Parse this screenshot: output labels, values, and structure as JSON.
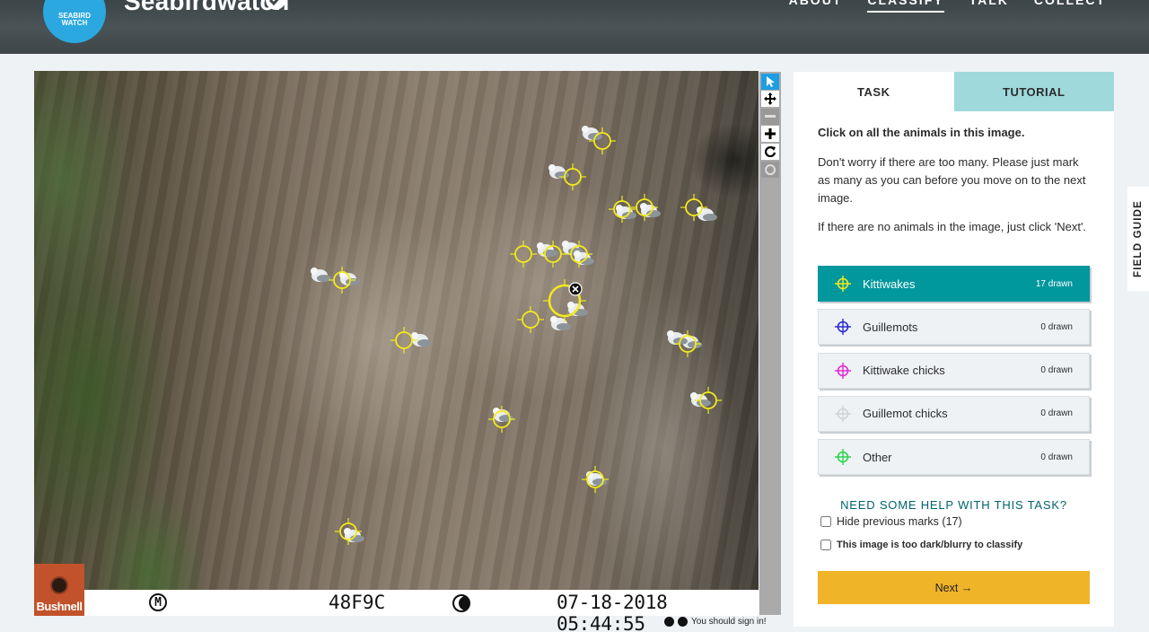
{
  "header": {
    "logo_text": "SEABIRD WATCH",
    "project_title": "Seabirdwatch",
    "nav": [
      {
        "label": "ABOUT",
        "active": false
      },
      {
        "label": "CLASSIFY",
        "active": true
      },
      {
        "label": "TALK",
        "active": false
      },
      {
        "label": "COLLECT",
        "active": false
      }
    ]
  },
  "subject": {
    "camera_brand": "Bushnell",
    "moon_mark": "M",
    "camera_code": "48F9C",
    "timestamp": "07-18-2018 05:44:55",
    "mark_color": "#f2ea1b"
  },
  "toolbar": {
    "tools": [
      "pointer-icon",
      "move-icon",
      "zoom-out-icon",
      "zoom-in-icon",
      "rotate-icon",
      "reset-icon"
    ]
  },
  "footer_note": "You should sign in!",
  "panel": {
    "tabs": {
      "task": "TASK",
      "tutorial": "TUTORIAL"
    },
    "question": "Click on all the animals in this image.",
    "help_1": "Don't worry if there are too many. Please just mark as many as you can before you move on to the next image.",
    "help_2": "If there are no animals in the image, just click 'Next'.",
    "tools": [
      {
        "label": "Kittiwakes",
        "count": "17 drawn",
        "color": "#f2ea1b",
        "selected": true
      },
      {
        "label": "Guillemots",
        "count": "0 drawn",
        "color": "#2a2ad4",
        "selected": false
      },
      {
        "label": "Kittiwake chicks",
        "count": "0 drawn",
        "color": "#e02bd6",
        "selected": false
      },
      {
        "label": "Guillemot chicks",
        "count": "0 drawn",
        "color": "#cfd3d6",
        "selected": false
      },
      {
        "label": "Other",
        "count": "0 drawn",
        "color": "#2bd44a",
        "selected": false
      }
    ],
    "need_help": "NEED SOME HELP WITH THIS TASK?",
    "hide_marks": "Hide previous marks (17)",
    "too_dark": "This image is too dark/blurry to classify",
    "next": "Next →"
  },
  "field_guide": "FIELD GUIDE"
}
